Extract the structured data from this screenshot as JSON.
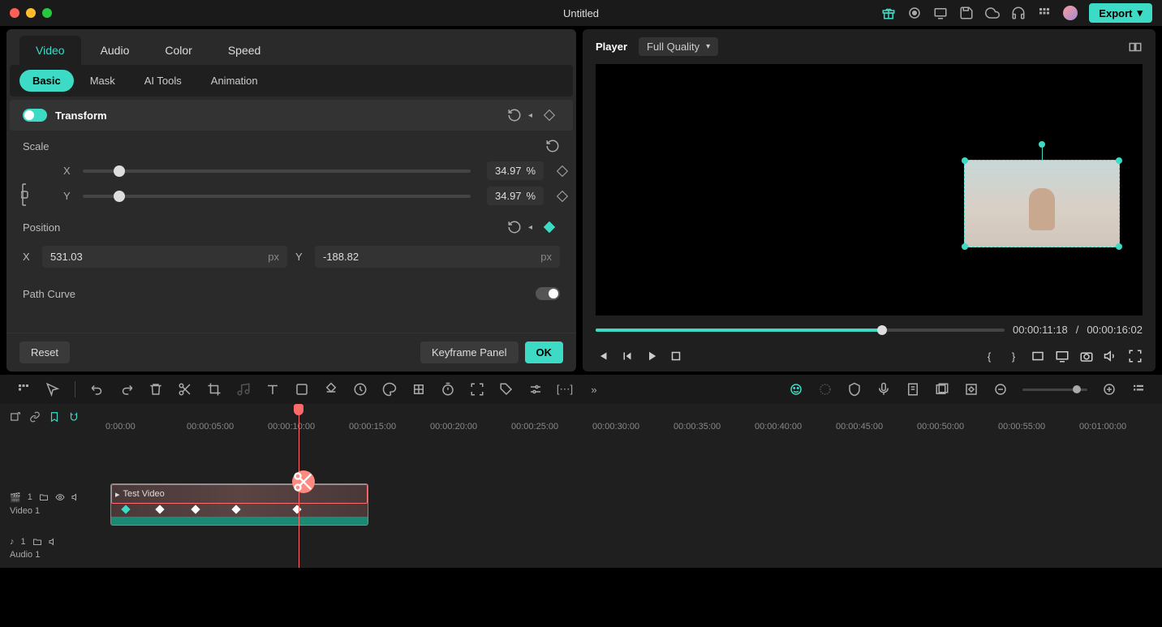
{
  "title": "Untitled",
  "export_label": "Export",
  "primary_tabs": [
    "Video",
    "Audio",
    "Color",
    "Speed"
  ],
  "secondary_tabs": [
    "Basic",
    "Mask",
    "AI Tools",
    "Animation"
  ],
  "transform": {
    "label": "Transform"
  },
  "scale": {
    "label": "Scale",
    "x_value": "34.97",
    "y_value": "34.97",
    "unit": "%",
    "x": "X",
    "y": "Y"
  },
  "position": {
    "label": "Position",
    "x_value": "531.03",
    "y_value": "-188.82",
    "unit": "px",
    "x": "X",
    "y": "Y"
  },
  "path_curve": {
    "label": "Path Curve"
  },
  "reset_label": "Reset",
  "keyframe_panel_label": "Keyframe Panel",
  "ok_label": "OK",
  "player": {
    "label": "Player",
    "quality": "Full Quality",
    "current_time": "00:00:11:18",
    "duration": "00:00:16:02"
  },
  "timeline": {
    "marks": [
      "0:00:00",
      "00:00:05:00",
      "00:00:10:00",
      "00:00:15:00",
      "00:00:20:00",
      "00:00:25:00",
      "00:00:30:00",
      "00:00:35:00",
      "00:00:40:00",
      "00:00:45:00",
      "00:00:50:00",
      "00:00:55:00",
      "00:01:00:00"
    ]
  },
  "tracks": {
    "video1": {
      "label": "Video 1",
      "num": "1"
    },
    "audio1": {
      "label": "Audio 1",
      "num": "1"
    }
  },
  "clip_name": "Test Video",
  "separator": "/"
}
